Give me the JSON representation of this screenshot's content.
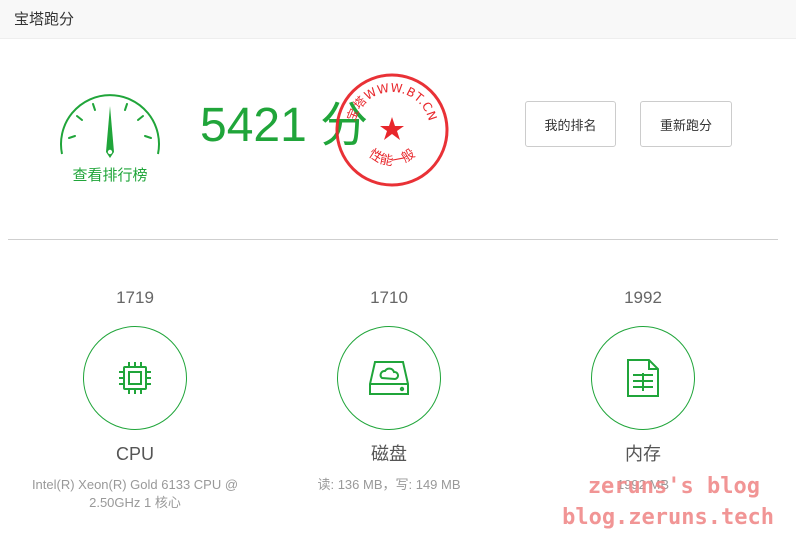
{
  "window": {
    "title": "宝塔跑分"
  },
  "summary": {
    "gauge_label": "查看排行榜",
    "score": "5421",
    "score_unit": "分",
    "stamp": {
      "top_text": "宝塔WWW.BT.CN",
      "bottom_text": "性能一般",
      "color": "#e8262b"
    }
  },
  "buttons": {
    "my_rank": "我的排名",
    "rerun": "重新跑分"
  },
  "metrics": {
    "cpu": {
      "score": "1719",
      "name": "CPU",
      "detail": "Intel(R) Xeon(R) Gold 6133 CPU @ 2.50GHz 1 核心",
      "icon": "cpu-chip-icon"
    },
    "disk": {
      "score": "1710",
      "name": "磁盘",
      "detail": "读: 136 MB，写: 149 MB",
      "icon": "hard-disk-icon"
    },
    "memory": {
      "score": "1992",
      "name": "内存",
      "detail": "1992 MB",
      "icon": "memory-document-icon"
    }
  },
  "watermark": {
    "line1": "zeruns's blog",
    "line2": "blog.zeruns.tech"
  },
  "colors": {
    "accent": "#20a53a",
    "stamp": "#e8262b",
    "watermark": "#f08a8a"
  }
}
